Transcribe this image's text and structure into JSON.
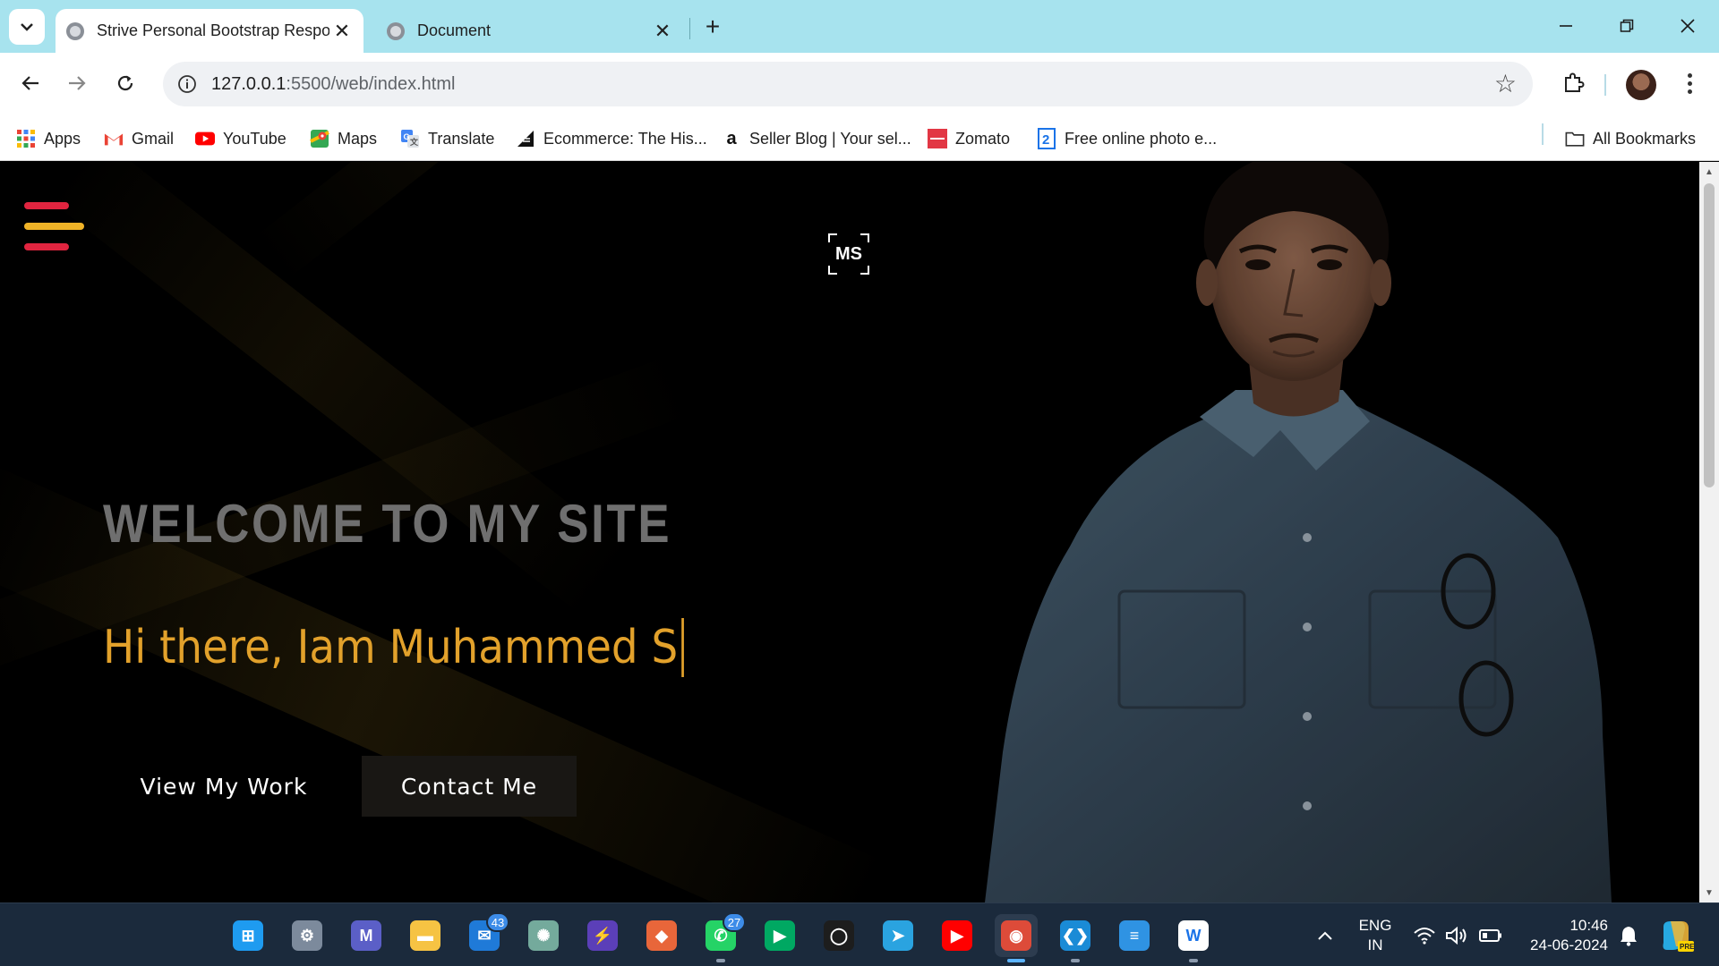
{
  "browser": {
    "tabs": [
      {
        "title": "Strive Personal Bootstrap Respo",
        "active": true
      },
      {
        "title": "Document",
        "active": false
      }
    ],
    "new_tab_symbol": "+",
    "close_symbol": "✕",
    "url_host": "127.0.0.1",
    "url_path": ":5500/web/index.html",
    "window_controls": {
      "minimize": "—",
      "restore": "❐",
      "close": "✕"
    }
  },
  "bookmarks": [
    {
      "label": "Apps",
      "icon": "apps-grid-icon",
      "color": "#4285f4"
    },
    {
      "label": "Gmail",
      "icon": "gmail-icon",
      "color": "#ea4335"
    },
    {
      "label": "YouTube",
      "icon": "youtube-icon",
      "color": "#ff0000"
    },
    {
      "label": "Maps",
      "icon": "maps-icon",
      "color": "#34a853"
    },
    {
      "label": "Translate",
      "icon": "translate-icon",
      "color": "#4285f4"
    },
    {
      "label": "Ecommerce: The His...",
      "icon": "ecommerce-icon",
      "color": "#111111"
    },
    {
      "label": "Seller Blog | Your sel...",
      "icon": "amazon-icon",
      "color": "#111111"
    },
    {
      "label": "Zomato",
      "icon": "zomato-icon",
      "color": "#e23744"
    },
    {
      "label": "Free online photo e...",
      "icon": "photo-editor-icon",
      "color": "#1a73e8"
    }
  ],
  "all_bookmarks": "All Bookmarks",
  "site": {
    "logo_text": "MS",
    "headline": "WELCOME TO MY SITE",
    "typed_text": "Hi there, Iam Muhammed S",
    "buttons": {
      "view_work": "View My Work",
      "contact": "Contact Me"
    },
    "colors": {
      "hamburger_top": "#e0243f",
      "hamburger_mid": "#f0b327",
      "hamburger_bottom": "#e0243f",
      "accent": "#e2a12b",
      "headline": "#6f6f6f"
    }
  },
  "taskbar": {
    "apps": [
      {
        "name": "start-icon",
        "glyph": "⊞",
        "color": "#1e9bf0"
      },
      {
        "name": "settings-icon",
        "glyph": "⚙",
        "color": "#7c8a9c"
      },
      {
        "name": "teams-icon",
        "glyph": "M",
        "color": "#5b5fc7"
      },
      {
        "name": "file-explorer-icon",
        "glyph": "▬",
        "color": "#f6c343"
      },
      {
        "name": "mail-icon",
        "glyph": "✉",
        "color": "#1f7ad8",
        "badge": "43"
      },
      {
        "name": "chatgpt-icon",
        "glyph": "✺",
        "color": "#74aa9c"
      },
      {
        "name": "power-automate-icon",
        "glyph": "⚡",
        "color": "#5b3fb8"
      },
      {
        "name": "git-icon",
        "glyph": "◆",
        "color": "#e8663a"
      },
      {
        "name": "whatsapp-icon",
        "glyph": "✆",
        "color": "#25d366",
        "badge": "27"
      },
      {
        "name": "meet-icon",
        "glyph": "▶",
        "color": "#00a862"
      },
      {
        "name": "search-app-icon",
        "glyph": "◯",
        "color": "#1d1d1d"
      },
      {
        "name": "telegram-icon",
        "glyph": "➤",
        "color": "#2aa3e0"
      },
      {
        "name": "youtube-app-icon",
        "glyph": "▶",
        "color": "#ff0000"
      },
      {
        "name": "chrome-icon",
        "glyph": "◉",
        "color": "#dd4b39",
        "active": true
      },
      {
        "name": "vscode-icon",
        "glyph": "❮❯",
        "color": "#1a8bd6"
      },
      {
        "name": "notepad-icon",
        "glyph": "≡",
        "color": "#2f93e3"
      },
      {
        "name": "word-app-icon",
        "glyph": "W",
        "color": "#ffffff"
      }
    ],
    "lang_top": "ENG",
    "lang_bottom": "IN",
    "time": "10:46",
    "date": "24-06-2024"
  }
}
